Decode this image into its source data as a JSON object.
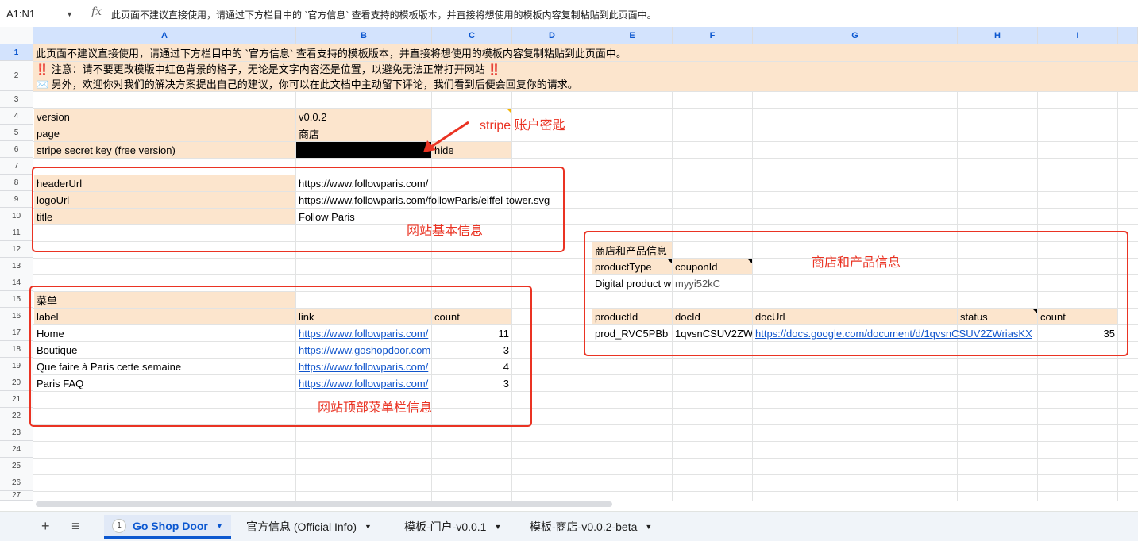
{
  "formula_bar": {
    "namebox": "A1:N1",
    "fx": "fx",
    "content": "此页面不建议直接使用，请通过下方栏目中的 `官方信息` 查看支持的模板版本，并直接将想使用的模板内容复制粘贴到此页面中。"
  },
  "columns": [
    "A",
    "B",
    "C",
    "D",
    "E",
    "F",
    "G",
    "H",
    "I"
  ],
  "rows": [
    "1",
    "2",
    "3",
    "4",
    "5",
    "6",
    "7",
    "8",
    "9",
    "10",
    "11",
    "12",
    "13",
    "14",
    "15",
    "16",
    "17",
    "18",
    "19",
    "20",
    "21",
    "22",
    "23",
    "24",
    "25",
    "26",
    "27"
  ],
  "cells": {
    "r1": "此页面不建议直接使用，请通过下方栏目中的 `官方信息` 查看支持的模板版本，并直接将想使用的模板内容复制粘贴到此页面中。",
    "r2_line1": "‼️ 注意：请不要更改模版中红色背景的格子，无论是文字内容还是位置，以避免无法正常打开网站 ‼️",
    "r2_line2": "✉️ 另外，欢迎你对我们的解决方案提出自己的建议，你可以在此文档中主动留下评论，我们看到后便会回复你的请求。",
    "version_label": "version",
    "version_value": "v0.0.2",
    "page_label": "page",
    "page_value": "商店",
    "stripe_label": "stripe secret key (free version)",
    "stripe_hide": "hide",
    "headerUrl_label": "headerUrl",
    "headerUrl_value": "https://www.followparis.com/",
    "logoUrl_label": "logoUrl",
    "logoUrl_value": "https://www.followparis.com/followParis/eiffel-tower.svg",
    "title_label": "title",
    "title_value": "Follow Paris",
    "menu_title": "菜单",
    "menu_headers": {
      "label": "label",
      "link": "link",
      "count": "count"
    },
    "menu_rows": [
      {
        "label": "Home",
        "link": "https://www.followparis.com/",
        "count": "11"
      },
      {
        "label": "Boutique",
        "link": "https://www.goshopdoor.com",
        "count": "3"
      },
      {
        "label": "Que faire à Paris cette semaine",
        "link": "https://www.followparis.com/",
        "count": "4"
      },
      {
        "label": "Paris FAQ",
        "link": "https://www.followparis.com/",
        "count": "3"
      }
    ],
    "shop_title": "商店和产品信息",
    "productType_label": "productType",
    "couponId_label": "couponId",
    "productType_value": "Digital product w",
    "couponId_value": "myyi52kC",
    "product_headers": {
      "productId": "productId",
      "docId": "docId",
      "docUrl": "docUrl",
      "status": "status",
      "count": "count"
    },
    "product_row": {
      "productId": "prod_RVC5PBb",
      "docId": "1qvsnCSUV2ZW",
      "docUrl": "https://docs.google.com/document/d/1qvsnCSUV2ZWriasKX",
      "status": "",
      "count": "35"
    }
  },
  "annotations": {
    "stripe": "stripe 账户密匙",
    "site_basic": "网站基本信息",
    "shop_info": "商店和产品信息",
    "menu_info": "网站顶部菜单栏信息"
  },
  "colors": {
    "annotation_red": "#ea3323",
    "peach": "#fce5cd",
    "link": "#1155cc",
    "active_tab": "#0b57d0"
  },
  "tabs": {
    "add_icon": "+",
    "list_icon": "≡",
    "items": [
      {
        "num": "1",
        "label": "Go Shop Door",
        "active": true
      },
      {
        "label": "官方信息 (Official Info)"
      },
      {
        "label": "模板-门户-v0.0.1"
      },
      {
        "label": "模板-商店-v0.0.2-beta"
      }
    ]
  }
}
